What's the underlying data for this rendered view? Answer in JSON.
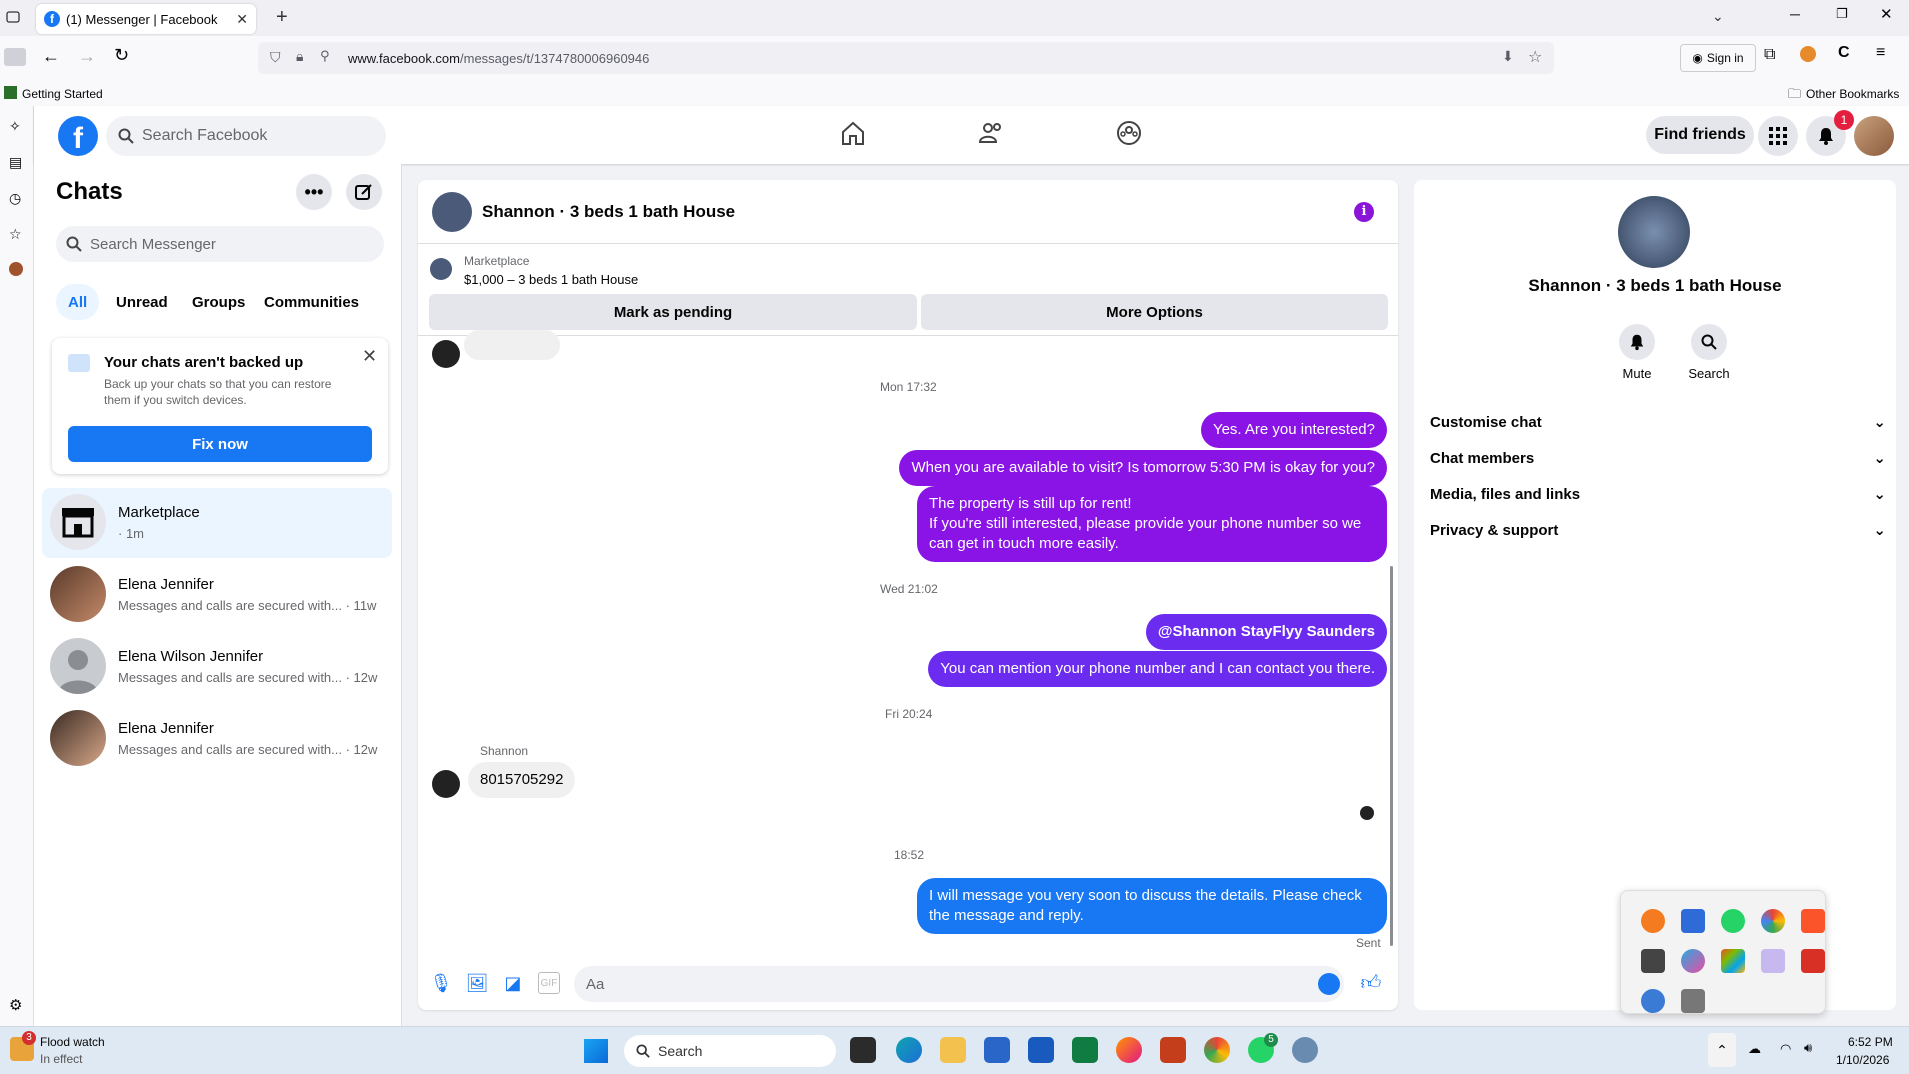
{
  "browser": {
    "tab_title": "(1) Messenger | Facebook",
    "tab_close": "✕",
    "new_tab": "+",
    "url_domain": "www.facebook.com",
    "url_path": "/messages/t/1374780006960946",
    "sign_in": "Sign in",
    "bookmark_getting_started": "Getting Started",
    "other_bookmarks": "Other Bookmarks"
  },
  "fb": {
    "logo": "f",
    "search_placeholder": "Search Facebook",
    "find_friends": "Find friends",
    "notif_count": "1"
  },
  "chats": {
    "title": "Chats",
    "search_placeholder": "Search Messenger",
    "filters": [
      "All",
      "Unread",
      "Groups",
      "Communities"
    ],
    "backup": {
      "title": "Your chats aren't backed up",
      "body": "Back up your chats so that you can restore them if you switch devices.",
      "button": "Fix now"
    },
    "items": [
      {
        "name": "Marketplace",
        "snippet": "· 1m"
      },
      {
        "name": "Elena Jennifer",
        "snippet": "Messages and calls are secured with... · 11w"
      },
      {
        "name": "Elena Wilson Jennifer",
        "snippet": "Messages and calls are secured with... · 12w"
      },
      {
        "name": "Elena Jennifer",
        "snippet": "Messages and calls are secured with... · 12w"
      }
    ]
  },
  "conversation": {
    "title": "Shannon · 3 beds 1 bath House",
    "marketplace_label": "Marketplace",
    "listing": "$1,000 – 3 beds 1 bath House",
    "mark_pending": "Mark as pending",
    "more_options": "More Options",
    "ts1": "Mon 17:32",
    "m1": "Yes. Are you interested?",
    "m2": "When you are available to visit? Is tomorrow 5:30 PM is okay for you?",
    "m3a": "The property is still up for rent!",
    "m3b": "If you're still interested, please provide your phone number so we can get in touch more easily.",
    "ts2": "Wed 21:02",
    "m4": "@Shannon StayFlyy Saunders",
    "m5": "You can mention your phone number and I can contact you there.",
    "ts3": "Fri 20:24",
    "sender": "Shannon",
    "in1": "8015705292",
    "ts4": "18:52",
    "m6": "I will message you very soon to discuss the details. Please check the message and reply.",
    "sent": "Sent",
    "composer_placeholder": "Aa"
  },
  "info_panel": {
    "name": "Shannon · 3 beds 1 bath House",
    "mute": "Mute",
    "search": "Search",
    "sections": [
      "Customise chat",
      "Chat members",
      "Media, files and links",
      "Privacy & support"
    ]
  },
  "taskbar": {
    "weather_title": "Flood watch",
    "weather_sub": "In effect",
    "weather_badge": "3",
    "search": "Search",
    "time": "6:52 PM",
    "date": "1/10/2026",
    "whatsapp_badge": "5"
  },
  "colors": {
    "fb_blue": "#1877f2",
    "bubble_purple": "#8a14e6",
    "page_bg": "#f0f2f5"
  }
}
